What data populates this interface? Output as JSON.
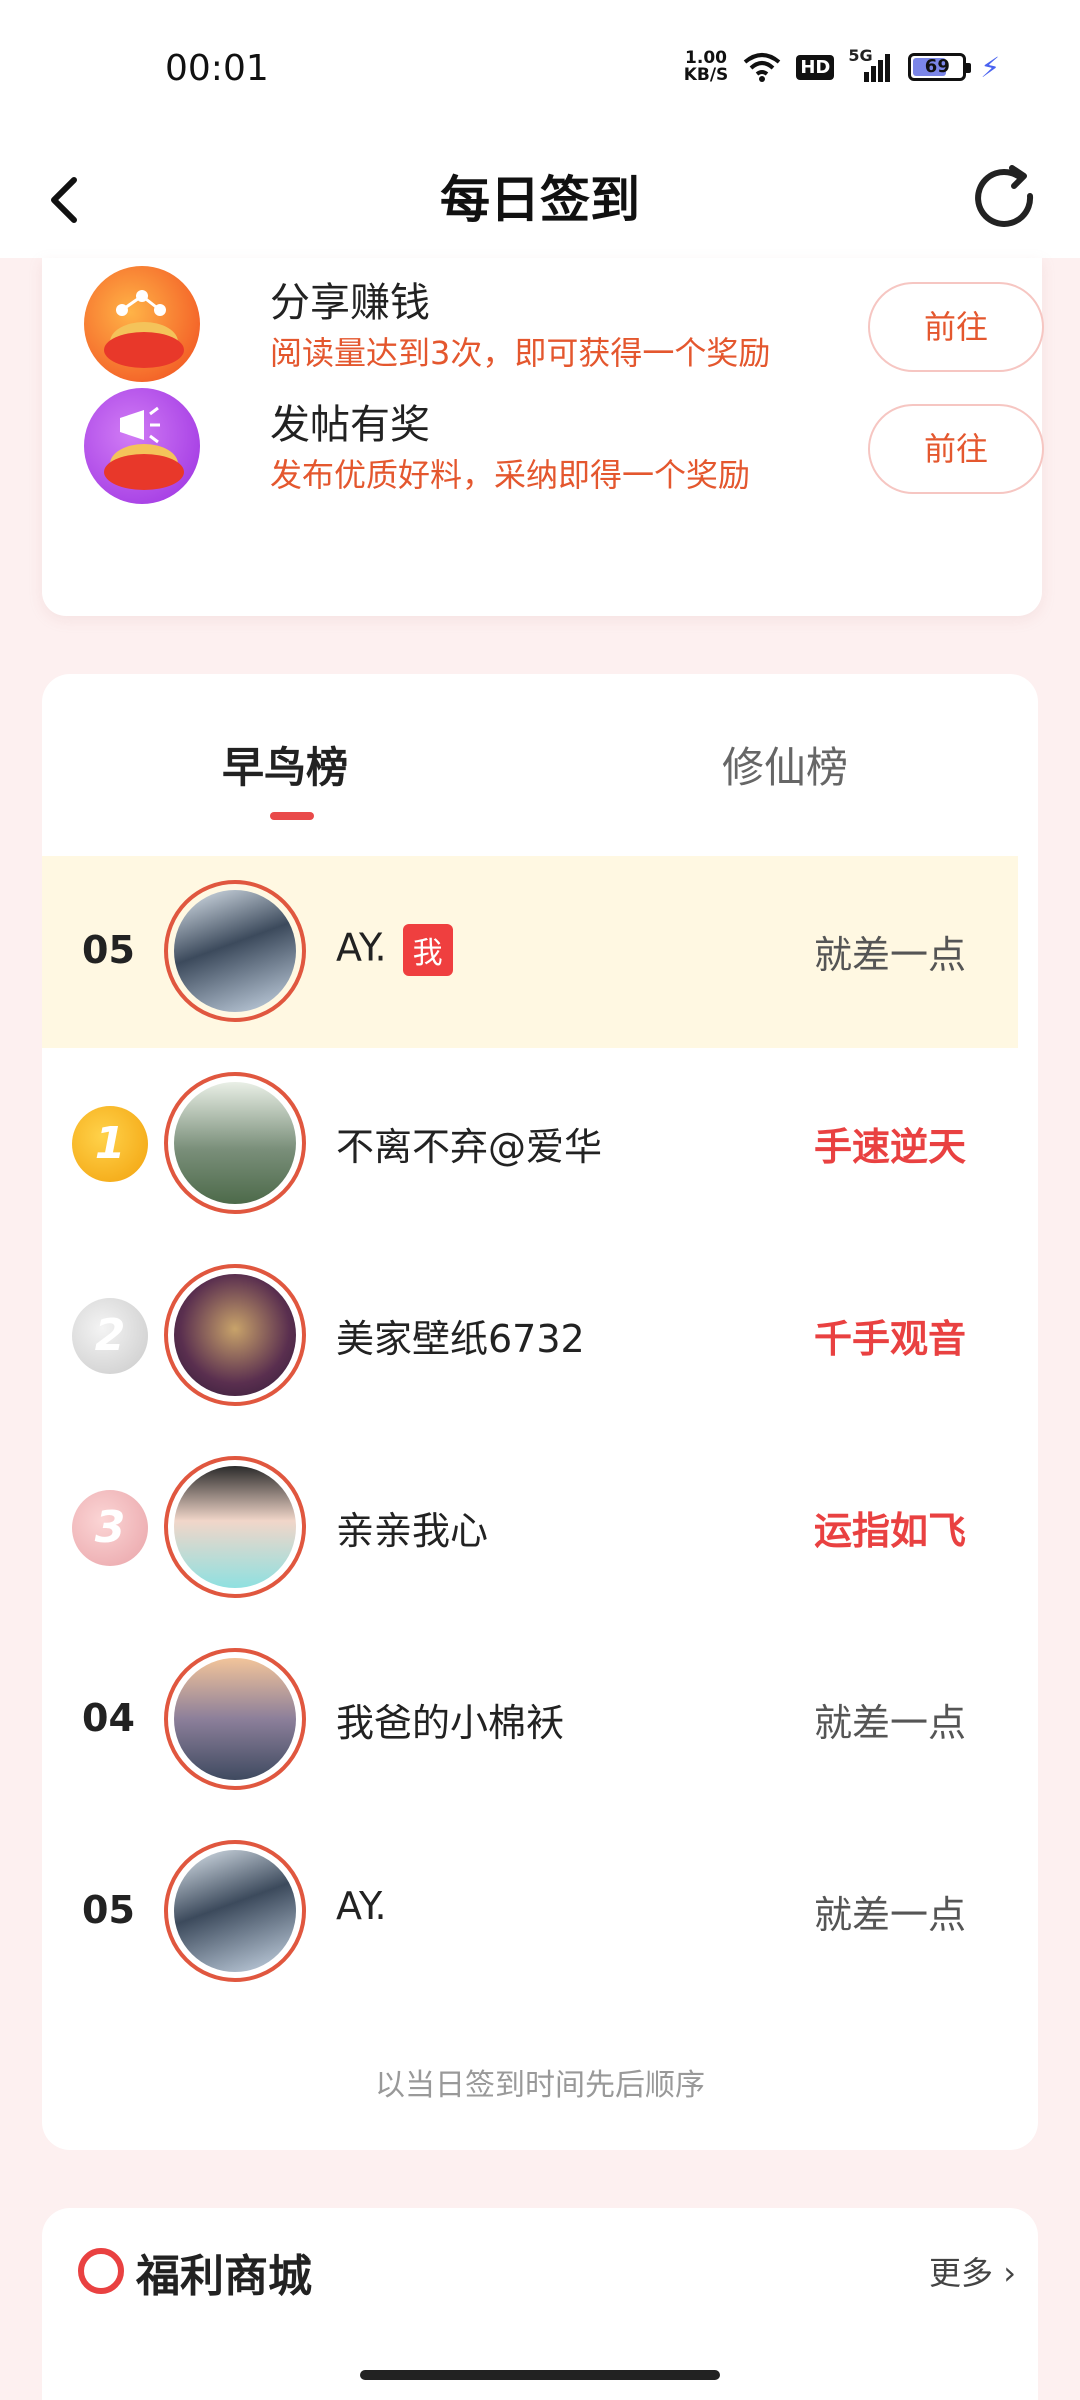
{
  "status_bar": {
    "time": "00:01",
    "net_speed_value": "1.00",
    "net_speed_unit": "KB/S",
    "hd": "HD",
    "signal": "5G",
    "battery_level": 69,
    "battery_text": "69"
  },
  "header": {
    "title": "每日签到",
    "back_icon": "chevron-left-icon",
    "refresh_icon": "refresh-icon"
  },
  "tasks": [
    {
      "title": "分享赚钱",
      "desc": "阅读量达到3次，即可获得一个奖励",
      "button": "前往",
      "icon": "share-coin-icon"
    },
    {
      "title": "发帖有奖",
      "desc": "发布优质好料，采纳即得一个奖励",
      "button": "前往",
      "icon": "megaphone-coin-icon"
    }
  ],
  "ranking": {
    "tabs": [
      "早鸟榜",
      "修仙榜"
    ],
    "active_tab": "早鸟榜",
    "me": {
      "rank": "05",
      "name": "AY.",
      "badge": "我",
      "status": "就差一点"
    },
    "rows": [
      {
        "rank": "1",
        "name": "不离不弃@爱华",
        "status": "手速逆天"
      },
      {
        "rank": "2",
        "name": "美家壁纸6732",
        "status": "千手观音"
      },
      {
        "rank": "3",
        "name": "亲亲我心",
        "status": "运指如飞"
      },
      {
        "rank": "04",
        "name": "我爸的小棉袄",
        "status": "就差一点"
      },
      {
        "rank": "05",
        "name": "AY.",
        "status": "就差一点"
      }
    ],
    "note": "以当日签到时间先后顺序"
  },
  "mall": {
    "title": "福利商城",
    "more": "更多"
  },
  "colors": {
    "accent_red": "#e94141",
    "orange_text": "#e4572e",
    "me_row_bg": "#fff8e2"
  }
}
